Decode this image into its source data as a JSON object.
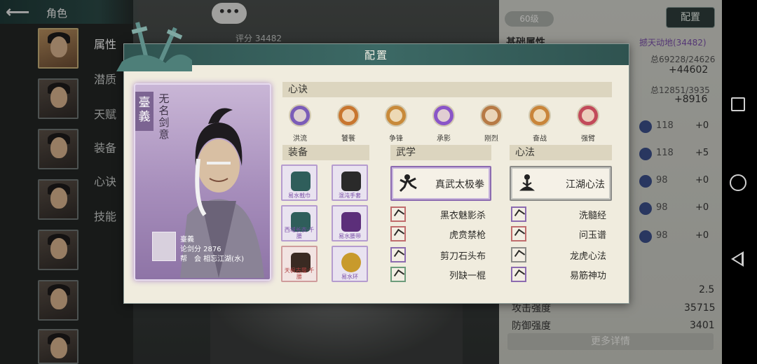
{
  "topbar": {
    "title": "角色"
  },
  "sidebar_tabs": [
    "属性",
    "潜质",
    "天赋",
    "装备",
    "心诀",
    "技能"
  ],
  "background": {
    "level": "60级",
    "config_button": "配置",
    "score_label": "评分 34482",
    "rp": {
      "line1_left": "基础属性",
      "line1_right": "撼天动地(34482)",
      "hp_ratio": "总69228/24626",
      "hp_plus": "+44602",
      "mp_ratio": "总12851/3935",
      "mp_plus": "+8916",
      "rows": [
        {
          "val": "118",
          "plus": "+0"
        },
        {
          "val": "118",
          "plus": "+5"
        },
        {
          "val": "98",
          "plus": "+0"
        },
        {
          "val": "98",
          "plus": "+0"
        },
        {
          "val": "98",
          "plus": "+0"
        }
      ],
      "stat1_value": "2.5",
      "stat2_label": "攻击强度",
      "stat2_value": "35715",
      "stat3_label": "防御强度",
      "stat3_value": "3401",
      "more_button": "更多详情"
    }
  },
  "modal": {
    "title": "配置",
    "card": {
      "name": "臺義",
      "motto": "无名剑意",
      "info_name": "臺義",
      "info_score": "论剑分 2876",
      "info_guild": "帮　会 相忘江湖(水)"
    },
    "sections": {
      "mindset": "心诀",
      "equipment": "装备",
      "martial": "武学",
      "method": "心法"
    },
    "mindset_skills": [
      {
        "label": "洪流",
        "color": "#7b5cb8"
      },
      {
        "label": "饕餮",
        "color": "#c8762f"
      },
      {
        "label": "争锋",
        "color": "#c88a3a"
      },
      {
        "label": "承影",
        "color": "#8a55c8"
      },
      {
        "label": "刚烈",
        "color": "#b77a45"
      },
      {
        "label": "奋战",
        "color": "#c9853a"
      },
      {
        "label": "强臂",
        "color": "#c24a5a"
      }
    ],
    "equipment": [
      {
        "name": "易水戟巾",
        "color": "#2f5e5b"
      },
      {
        "name": "混沌手套",
        "color": "#2a2a2a"
      },
      {
        "name": "西域长衣·千腰",
        "color": "#2f5e5b"
      },
      {
        "name": "易水腰带",
        "color": "#5c2f7a"
      },
      {
        "name": "天枫古履·千腰",
        "color": "#3a2a22"
      },
      {
        "name": "易水环",
        "color": "#c89a2c"
      }
    ],
    "martial_main": "真武太极拳",
    "method_main": "江湖心法",
    "martial_subs": [
      "黑衣魅影杀",
      "虎贲禁枪",
      "剪刀石头布",
      "列缺一棍"
    ],
    "method_subs": [
      "洗髓经",
      "问玉谱",
      "龙虎心法",
      "易筋神功"
    ]
  },
  "colors": {
    "modal_header": "#3c6965",
    "card_purple": "#a68dbb",
    "equip_purple": "#b59ccf",
    "equip_red": "#cf9c9c"
  }
}
